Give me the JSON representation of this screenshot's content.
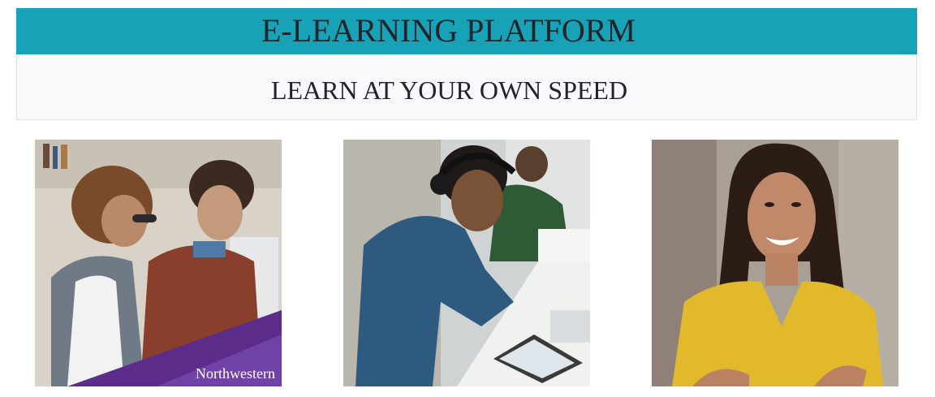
{
  "header": {
    "title": "E-LEARNING PLATFORM",
    "subtitle": "LEARN AT YOUR OWN SPEED"
  },
  "cards": [
    {
      "image": "two-students-studying-photo",
      "logo_text": "Northwestern"
    },
    {
      "image": "student-with-headphones-tablet-photo"
    },
    {
      "image": "smiling-woman-portrait-photo"
    }
  ],
  "colors": {
    "banner": "#17a2b8",
    "subheader_bg": "#f8f9fa",
    "text": "#212529",
    "logo_purple": "#5b2c8a"
  }
}
